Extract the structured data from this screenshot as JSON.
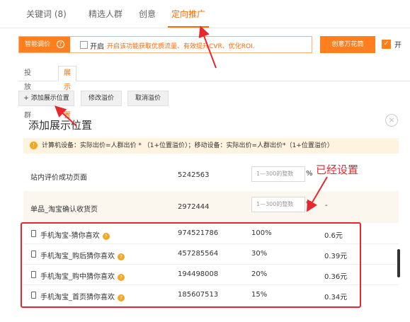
{
  "top_tabs": [
    "关键词 (8)",
    "精选人群",
    "创意",
    "定向推广"
  ],
  "smart_bid": {
    "button_label": "智能调价",
    "help_glyph": "?",
    "toggle_label": "开启",
    "description": "开启该功能获取优质流量、有效提升CVR、优化ROI.",
    "checked": false
  },
  "creative": {
    "button_label": "创意万花筒",
    "check_label": "开",
    "checked": true
  },
  "sub_tabs": [
    "投放人群",
    "展示位置"
  ],
  "actions": {
    "add_position": "+ 添加展示位置",
    "modify_premium": "修改溢价",
    "cancel_premium": "取消溢价"
  },
  "panel": {
    "title": "添加展示位置",
    "close_glyph": "×",
    "notice": "计算机设备：实际出价=人群出价 * （1+位置溢价）；移动设备：实际出价=人群出价*（1+位置溢价）",
    "notice_icon": "!"
  },
  "input_rows": [
    {
      "name": "站内评价成功页面",
      "value": "5242563",
      "placeholder": "1—300的整数",
      "unit": "%",
      "extra": ""
    },
    {
      "name": "单品_淘宝确认收货页",
      "value": "2972444",
      "placeholder": "1—300的整数",
      "unit": "%",
      "extra": "-"
    }
  ],
  "set_rows": [
    {
      "name": "手机淘宝-猜你喜欢",
      "value": "974521786",
      "percent": "100%",
      "price": "0.6元"
    },
    {
      "name": "手机淘宝_购后猜你喜欢",
      "value": "457285564",
      "percent": "30%",
      "price": "0.39元"
    },
    {
      "name": "手机淘宝_购中猜你喜欢",
      "value": "194498008",
      "percent": "20%",
      "price": "0.36元"
    },
    {
      "name": "手机淘宝_首页猜你喜欢",
      "value": "185607513",
      "percent": "15%",
      "price": "0.34元"
    }
  ],
  "annotation": "已经设置",
  "colors": {
    "accent": "#ff6a00",
    "button": "#ff7f1e",
    "annotation": "#e8262e",
    "notice_bg": "#fef3df"
  }
}
